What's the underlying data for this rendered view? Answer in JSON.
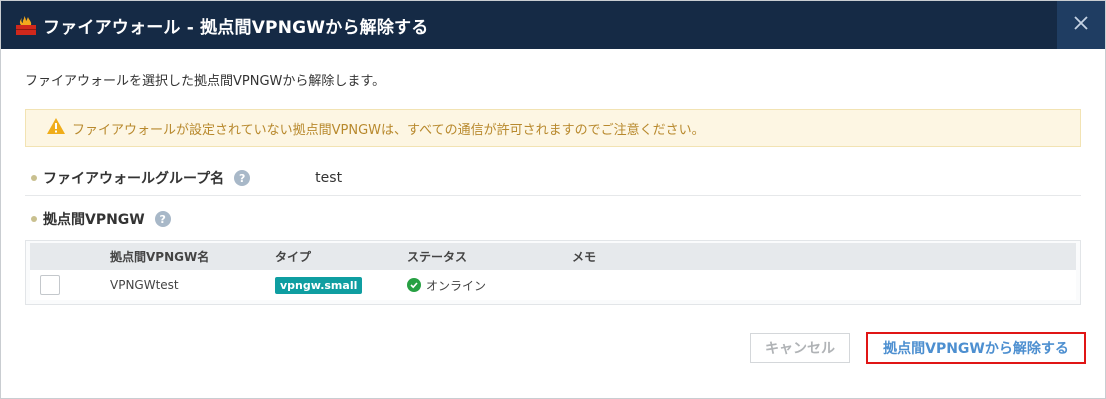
{
  "background": {
    "partial_text": ""
  },
  "dialog": {
    "title": "ファイアウォール - 拠点間VPNGWから解除する",
    "close_icon": "close-icon",
    "description": "ファイアウォールを選択した拠点間VPNGWから解除します。",
    "warning": "ファイアウォールが設定されていない拠点間VPNGWは、すべての通信が許可されますのでご注意ください。",
    "firewall_group": {
      "label": "ファイアウォールグループ名",
      "help": "?",
      "value": "test"
    },
    "vpngw_section": {
      "label": "拠点間VPNGW",
      "help": "?"
    },
    "table": {
      "headers": [
        "拠点間VPNGW名",
        "タイプ",
        "ステータス",
        "メモ"
      ],
      "rows": [
        {
          "name": "VPNGWtest",
          "type": "vpngw.small",
          "status": "オンライン",
          "memo": "",
          "checked": false
        }
      ]
    },
    "buttons": {
      "cancel": "キャンセル",
      "release": "拠点間VPNGWから解除する"
    }
  },
  "colors": {
    "header_bg": "#152a45",
    "close_bg": "#1f3d62",
    "warning_bg": "#fdf6e3",
    "warning_text": "#b8892d",
    "type_badge": "#0f9ea1",
    "status_ok": "#27a043",
    "highlight_border": "#e01515",
    "link_blue": "#4d8fd0"
  }
}
